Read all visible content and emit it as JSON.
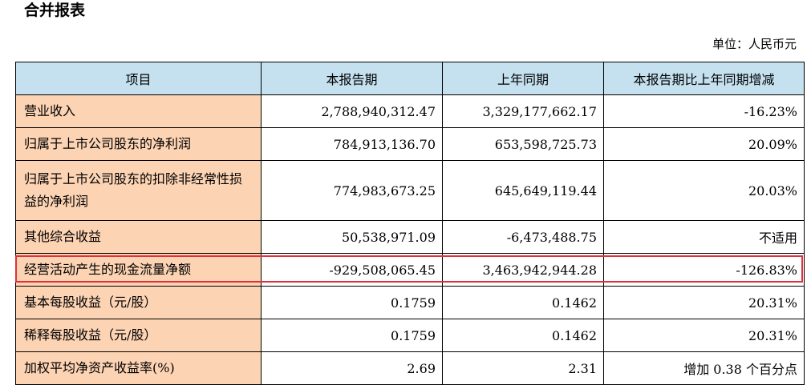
{
  "title": "合并报表",
  "unit": "单位：人民币元",
  "headers": [
    "项目",
    "本报告期",
    "上年同期",
    "本报告期比上年同期增减"
  ],
  "rows": [
    {
      "label": "营业收入",
      "current": "2,788,940,312.47",
      "prior": "3,329,177,662.17",
      "change": "-16.23%"
    },
    {
      "label": "归属于上市公司股东的净利润",
      "current": "784,913,136.70",
      "prior": "653,598,725.73",
      "change": "20.09%"
    },
    {
      "label": "归属于上市公司股东的扣除非经常性损益的净利润",
      "current": "774,983,673.25",
      "prior": "645,649,119.44",
      "change": "20.03%"
    },
    {
      "label": "其他综合收益",
      "current": "50,538,971.09",
      "prior": "-6,473,488.75",
      "change": "不适用"
    },
    {
      "label": "经营活动产生的现金流量净额",
      "current": "-929,508,065.45",
      "prior": "3,463,942,944.28",
      "change": "-126.83%"
    },
    {
      "label": "基本每股收益（元/股）",
      "current": "0.1759",
      "prior": "0.1462",
      "change": "20.31%"
    },
    {
      "label": "稀释每股收益（元/股）",
      "current": "0.1759",
      "prior": "0.1462",
      "change": "20.31%"
    },
    {
      "label": "加权平均净资产收益率(%)",
      "current": "2.69",
      "prior": "2.31",
      "change": "增加 0.38 个百分点"
    }
  ],
  "colors": {
    "header_bg": "#c5e1ef",
    "label_bg": "#fcd3b3",
    "highlight": "#e0303a"
  }
}
